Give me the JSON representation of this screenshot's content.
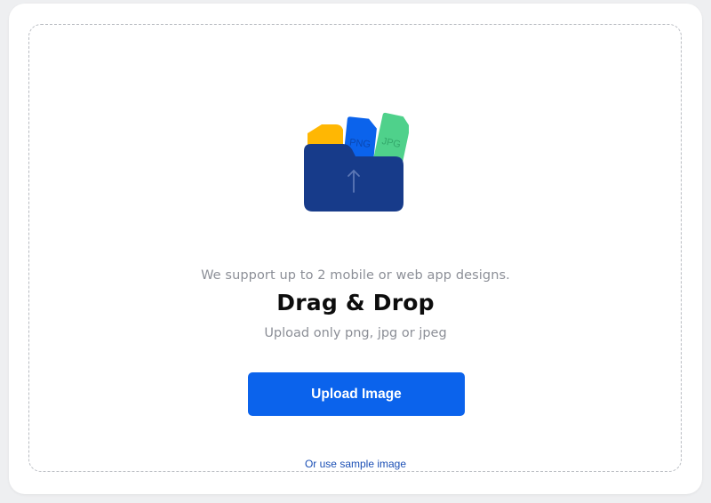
{
  "colors": {
    "accent": "#0b63ec",
    "folder": "#173b8a",
    "file_yellow": "#ffb703",
    "file_blue": "#0b63ec",
    "file_green": "#4fd18b"
  },
  "icons": {
    "folder": "folder-upload-icon"
  },
  "upload": {
    "file_labels": {
      "png": "PNG",
      "jpg": "JPG"
    },
    "support_text": "We support up to 2 mobile or web app designs.",
    "title": "Drag & Drop",
    "hint": "Upload only png, jpg or jpeg",
    "button_label": "Upload Image",
    "sample_link": "Or use sample image"
  }
}
